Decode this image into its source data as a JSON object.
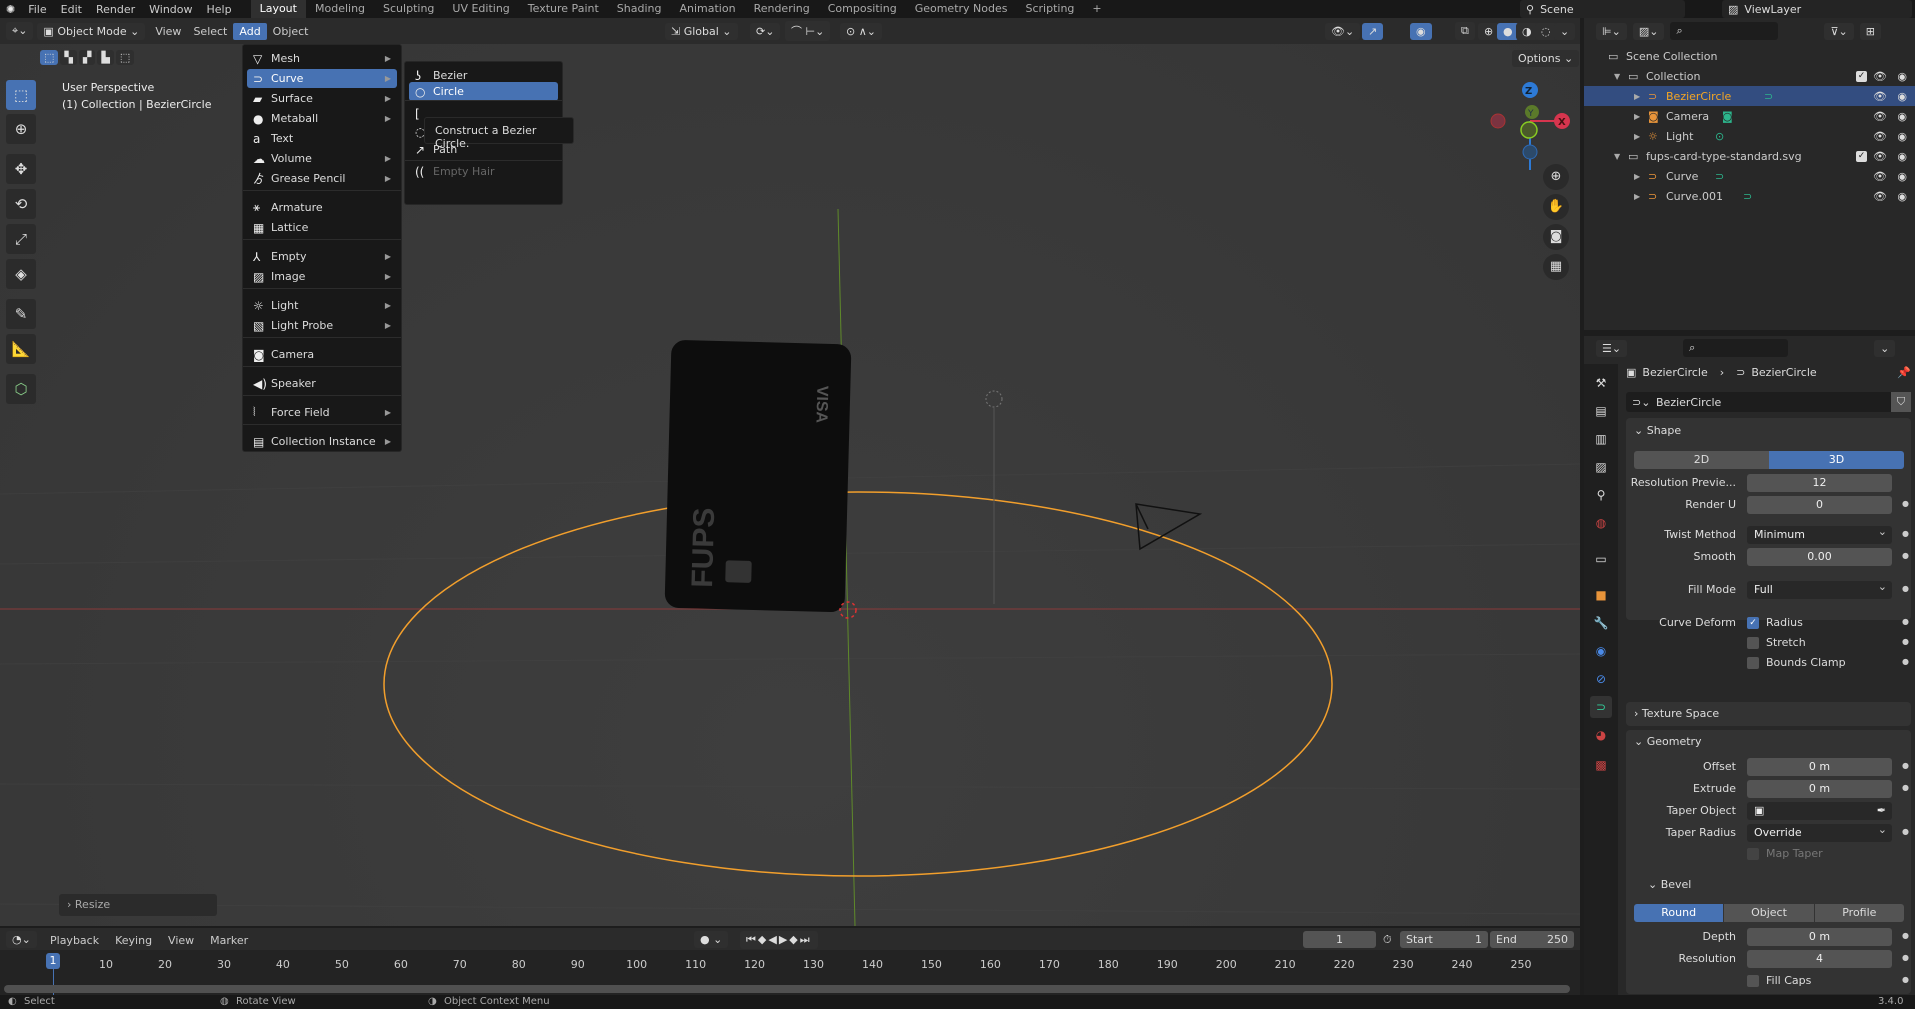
{
  "topbar": {
    "menus": [
      "File",
      "Edit",
      "Render",
      "Window",
      "Help"
    ],
    "workspaces": [
      "Layout",
      "Modeling",
      "Sculpting",
      "UV Editing",
      "Texture Paint",
      "Shading",
      "Animation",
      "Rendering",
      "Compositing",
      "Geometry Nodes",
      "Scripting"
    ],
    "active_workspace": "Layout",
    "add_workspace": "+",
    "scene": "Scene",
    "view_layer": "ViewLayer"
  },
  "viewport_header": {
    "mode": "Object Mode",
    "menus": [
      "View",
      "Select",
      "Add",
      "Object"
    ],
    "active_menu": "Add",
    "transform_orientation": "Global",
    "options": "Options"
  },
  "viewport": {
    "view_name": "User Perspective",
    "context": "(1) Collection | BezierCircle",
    "last_operator": "Resize",
    "gizmo_axes": {
      "x": "X",
      "y": "Y",
      "z": "Z"
    },
    "card_text": {
      "brand": "VISA",
      "name": "FUPS"
    },
    "colors": {
      "x_axis": "#d6354e",
      "y_axis": "#7fb52a",
      "z_axis": "#2d7ad6",
      "selection": "#f29f2c",
      "accent": "#4772b3"
    }
  },
  "add_menu": {
    "items": [
      {
        "label": "Mesh",
        "icon": "mesh-icon",
        "glyph": "▽",
        "submenu": true
      },
      {
        "label": "Curve",
        "icon": "curve-icon",
        "glyph": "⊃",
        "submenu": true,
        "highlighted": true
      },
      {
        "label": "Surface",
        "icon": "surface-icon",
        "glyph": "▰",
        "submenu": true
      },
      {
        "label": "Metaball",
        "icon": "metaball-icon",
        "glyph": "●",
        "submenu": true
      },
      {
        "label": "Text",
        "icon": "text-icon",
        "glyph": "a",
        "submenu": false
      },
      {
        "label": "Volume",
        "icon": "volume-icon",
        "glyph": "☁",
        "submenu": true
      },
      {
        "label": "Grease Pencil",
        "icon": "grease-pencil-icon",
        "glyph": "ゟ",
        "submenu": true
      },
      {
        "label": "Armature",
        "icon": "armature-icon",
        "glyph": "⚹",
        "submenu": false
      },
      {
        "label": "Lattice",
        "icon": "lattice-icon",
        "glyph": "▦",
        "submenu": false
      },
      {
        "label": "Empty",
        "icon": "empty-icon",
        "glyph": "⅄",
        "submenu": true
      },
      {
        "label": "Image",
        "icon": "image-icon",
        "glyph": "▨",
        "submenu": true
      },
      {
        "label": "Light",
        "icon": "light-icon",
        "glyph": "☼",
        "submenu": true
      },
      {
        "label": "Light Probe",
        "icon": "light-probe-icon",
        "glyph": "▧",
        "submenu": true
      },
      {
        "label": "Camera",
        "icon": "camera-icon",
        "glyph": "◙",
        "submenu": false
      },
      {
        "label": "Speaker",
        "icon": "speaker-icon",
        "glyph": "◀)",
        "submenu": false
      },
      {
        "label": "Force Field",
        "icon": "force-field-icon",
        "glyph": "⦚",
        "submenu": true
      },
      {
        "label": "Collection Instance",
        "icon": "collection-instance-icon",
        "glyph": "▤",
        "submenu": true
      }
    ]
  },
  "curve_submenu": {
    "items": [
      {
        "label": "Bezier",
        "icon": "bezier-icon",
        "glyph": "ʖ"
      },
      {
        "label": "Circle",
        "icon": "circle-icon",
        "glyph": "○",
        "highlighted": true
      },
      {
        "label": "",
        "icon": "nurbs-curve-icon",
        "glyph": "[",
        "hidden_by_tooltip": true
      },
      {
        "label": "",
        "icon": "nurbs-circle-icon",
        "glyph": "◌",
        "hidden_by_tooltip": true
      },
      {
        "label": "Path",
        "icon": "path-icon",
        "glyph": "↗"
      },
      {
        "label": "Empty Hair",
        "icon": "empty-hair-icon",
        "glyph": "((",
        "disabled": true
      }
    ],
    "tooltip": "Construct a Bezier Circle."
  },
  "outliner": {
    "rows": [
      {
        "label": "Scene Collection",
        "icon": "scene-collection-icon",
        "depth": 0
      },
      {
        "label": "Collection",
        "icon": "collection-icon",
        "depth": 1,
        "expanded": true,
        "checkbox": true
      },
      {
        "label": "BezierCircle",
        "icon": "curve-object-icon",
        "depth": 2,
        "selected": true,
        "data_icon": "curve-data-icon"
      },
      {
        "label": "Camera",
        "icon": "camera-object-icon",
        "depth": 2,
        "data_icon": "camera-data-icon"
      },
      {
        "label": "Light",
        "icon": "light-object-icon",
        "depth": 2,
        "data_icon": "light-data-icon"
      },
      {
        "label": "fups-card-type-standard.svg",
        "icon": "collection-icon",
        "depth": 1,
        "expanded": true,
        "checkbox": true
      },
      {
        "label": "Curve",
        "icon": "curve-object-icon",
        "depth": 2,
        "data_icon": "curve-data-icon"
      },
      {
        "label": "Curve.001",
        "icon": "curve-object-icon",
        "depth": 2,
        "data_icon": "curve-data-icon"
      }
    ]
  },
  "properties": {
    "breadcrumb": {
      "object": "BezierCircle",
      "data": "BezierCircle"
    },
    "datablock_name": "BezierCircle",
    "shape": {
      "title": "Shape",
      "dims": [
        "2D",
        "3D"
      ],
      "active_dim": "3D",
      "resolution_preview": {
        "label": "Resolution Previe...",
        "value": "12"
      },
      "render_u": {
        "label": "Render U",
        "value": "0"
      },
      "twist_method": {
        "label": "Twist Method",
        "value": "Minimum"
      },
      "smooth": {
        "label": "Smooth",
        "value": "0.00"
      },
      "fill_mode": {
        "label": "Fill Mode",
        "value": "Full"
      },
      "curve_deform": {
        "label": "Curve Deform",
        "radius": "Radius",
        "radius_checked": true,
        "stretch": "Stretch",
        "stretch_checked": false,
        "bounds_clamp": "Bounds Clamp",
        "bounds_clamp_checked": false
      }
    },
    "texture_space": {
      "title": "Texture Space"
    },
    "geometry": {
      "title": "Geometry",
      "offset": {
        "label": "Offset",
        "value": "0 m"
      },
      "extrude": {
        "label": "Extrude",
        "value": "0 m"
      },
      "taper_object": {
        "label": "Taper Object",
        "value": ""
      },
      "taper_radius": {
        "label": "Taper Radius",
        "value": "Override"
      },
      "map_taper": {
        "label": "Map Taper",
        "checked": false
      },
      "bevel": {
        "title": "Bevel",
        "modes": [
          "Round",
          "Object",
          "Profile"
        ],
        "active_mode": "Round",
        "depth": {
          "label": "Depth",
          "value": "0 m"
        },
        "resolution": {
          "label": "Resolution",
          "value": "4"
        },
        "fill_caps": {
          "label": "Fill Caps",
          "checked": false
        }
      }
    }
  },
  "timeline": {
    "menus": [
      "Playback",
      "Keying",
      "View",
      "Marker"
    ],
    "current_frame": "1",
    "start_label": "Start",
    "start": "1",
    "end_label": "End",
    "end": "250",
    "ticks": [
      "10",
      "20",
      "30",
      "40",
      "50",
      "60",
      "70",
      "80",
      "90",
      "100",
      "110",
      "120",
      "130",
      "140",
      "150",
      "160",
      "170",
      "180",
      "190",
      "200",
      "210",
      "220",
      "230",
      "240",
      "250"
    ],
    "playhead": "1"
  },
  "status_bar": {
    "items": [
      "Select",
      "Rotate View",
      "Object Context Menu"
    ],
    "version": "3.4.0"
  }
}
